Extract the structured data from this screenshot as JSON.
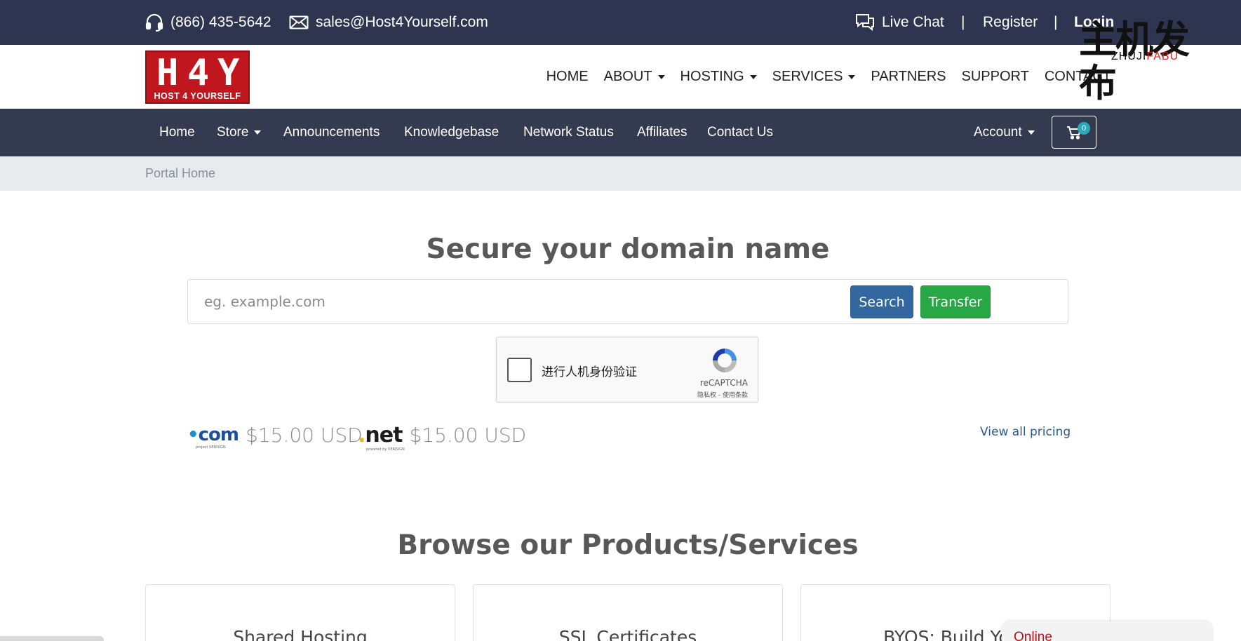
{
  "topbar": {
    "phone": "(866) 435-5642",
    "email": "sales@Host4Yourself.com",
    "live_chat": "Live Chat",
    "separator": "|",
    "register": "Register",
    "login": "Login"
  },
  "watermark": {
    "main": "主机发布",
    "sub_left": "ZHUJI",
    "sub_right": "FABU"
  },
  "logo": {
    "letters": [
      "H",
      "4",
      "Y"
    ],
    "tagline": "HOST 4 YOURSELF"
  },
  "main_nav": {
    "items": [
      {
        "label": "HOME",
        "dropdown": false
      },
      {
        "label": "ABOUT",
        "dropdown": true
      },
      {
        "label": "HOSTING",
        "dropdown": true
      },
      {
        "label": "SERVICES",
        "dropdown": true
      },
      {
        "label": "PARTNERS",
        "dropdown": false
      },
      {
        "label": "SUPPORT",
        "dropdown": false
      },
      {
        "label": "CONTACT",
        "dropdown": false
      }
    ]
  },
  "sub_nav": {
    "items": [
      {
        "label": "Home"
      },
      {
        "label": "Store"
      },
      {
        "label": "Announcements"
      },
      {
        "label": "Knowledgebase"
      },
      {
        "label": "Network Status"
      },
      {
        "label": "Affiliates"
      },
      {
        "label": "Contact Us"
      }
    ],
    "account": "Account",
    "cart_count": "0"
  },
  "breadcrumb": "Portal Home",
  "domain": {
    "title": "Secure your domain name",
    "placeholder": "eg. example.com",
    "search_button": "Search",
    "transfer_button": "Transfer"
  },
  "captcha": {
    "label": "进行人机身份验证",
    "brand": "reCAPTCHA",
    "terms": "隐私权 - 使用条款"
  },
  "tlds": [
    {
      "name": "com",
      "price": "$15.00 USD"
    },
    {
      "name": "net",
      "price": "$15.00 USD"
    }
  ],
  "view_all": "View all pricing",
  "products": {
    "title": "Browse our Products/Services",
    "cards": [
      {
        "label": "Shared Hosting"
      },
      {
        "label": "SSL Certificates"
      },
      {
        "label": "BYOS: Build Your"
      }
    ]
  },
  "chat_status": "Online",
  "colors": {
    "topbar": "#2e3551",
    "subnav": "#343a4f",
    "search_button": "#32679f",
    "transfer_button": "#28a745",
    "logo_red": "#c0161d"
  }
}
